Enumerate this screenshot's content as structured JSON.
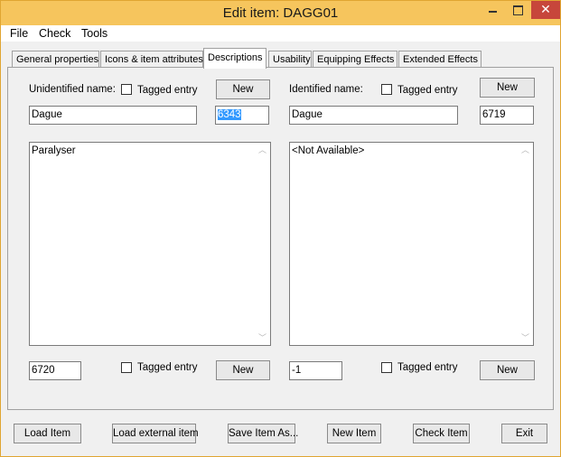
{
  "window": {
    "title": "Edit item: DAGG01"
  },
  "menu": [
    "File",
    "Check",
    "Tools"
  ],
  "tabs": [
    {
      "label": "General properties"
    },
    {
      "label": "Icons & item attributes"
    },
    {
      "label": "Descriptions"
    },
    {
      "label": "Usability"
    },
    {
      "label": "Equipping Effects"
    },
    {
      "label": "Extended Effects"
    }
  ],
  "unidentified": {
    "label": "Unidentified name:",
    "tagged_label": "Tagged entry",
    "new_label": "New",
    "name_value": "Dague",
    "strref": "6343",
    "description": "Paralyser",
    "desc_strref": "6720",
    "desc_tagged_label": "Tagged entry",
    "desc_new_label": "New"
  },
  "identified": {
    "label": "Identified name:",
    "tagged_label": "Tagged entry",
    "new_label": "New",
    "name_value": "Dague",
    "strref": "6719",
    "description": "<Not Available>",
    "desc_strref": "-1",
    "desc_tagged_label": "Tagged entry",
    "desc_new_label": "New"
  },
  "bottom_buttons": {
    "load_item": "Load Item",
    "load_external": "Load external item",
    "save_as": "Save Item As...",
    "new_item": "New Item",
    "check_item": "Check Item",
    "exit": "Exit"
  },
  "icons": {
    "close": "close-icon",
    "minimize": "minimize-icon",
    "maximize": "maximize-icon",
    "scroll_up": "chevron-up-icon",
    "scroll_down": "chevron-down-icon"
  }
}
